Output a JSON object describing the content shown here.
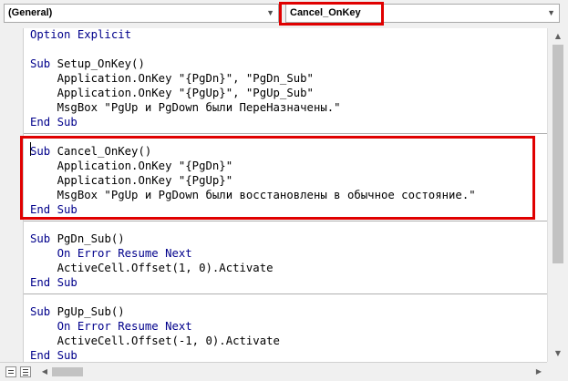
{
  "procedure_bar": {
    "object_value": "(General)",
    "procedure_value": "Cancel_OnKey"
  },
  "code": {
    "lines": [
      {
        "kw": "Option Explicit",
        "text": ""
      },
      {
        "kw": "",
        "text": ""
      },
      {
        "kw": "Sub",
        "text": " Setup_OnKey()"
      },
      {
        "kw": "",
        "text": "    Application.OnKey \"{PgDn}\", \"PgDn_Sub\""
      },
      {
        "kw": "",
        "text": "    Application.OnKey \"{PgUp}\", \"PgUp_Sub\""
      },
      {
        "kw": "",
        "text": "    MsgBox \"PgUp и PgDown были ПереНазначены.\""
      },
      {
        "kw": "End Sub",
        "text": ""
      },
      {
        "kw": "",
        "text": ""
      },
      {
        "kw": "Sub",
        "text": " Cancel_OnKey()"
      },
      {
        "kw": "",
        "text": "    Application.OnKey \"{PgDn}\""
      },
      {
        "kw": "",
        "text": "    Application.OnKey \"{PgUp}\""
      },
      {
        "kw": "",
        "text": "    MsgBox \"PgUp и PgDown были восстановлены в обычное состояние.\""
      },
      {
        "kw": "End Sub",
        "text": ""
      },
      {
        "kw": "",
        "text": ""
      },
      {
        "kw": "Sub",
        "text": " PgDn_Sub()"
      },
      {
        "kw": "    On Error Resume Next",
        "text": ""
      },
      {
        "kw": "",
        "text": "    ActiveCell.Offset(1, 0).Activate"
      },
      {
        "kw": "End Sub",
        "text": ""
      },
      {
        "kw": "",
        "text": ""
      },
      {
        "kw": "Sub",
        "text": " PgUp_Sub()"
      },
      {
        "kw": "    On Error Resume Next",
        "text": ""
      },
      {
        "kw": "",
        "text": "    ActiveCell.Offset(-1, 0).Activate"
      },
      {
        "kw": "End Sub",
        "text": ""
      }
    ]
  },
  "colors": {
    "keyword": "#00008b",
    "highlight_border": "#e00000"
  },
  "icons": {
    "dropdown": "chevron-down-icon",
    "scroll_up": "arrow-up-icon",
    "scroll_down": "arrow-down-icon",
    "scroll_left": "arrow-left-icon",
    "scroll_right": "arrow-right-icon"
  }
}
